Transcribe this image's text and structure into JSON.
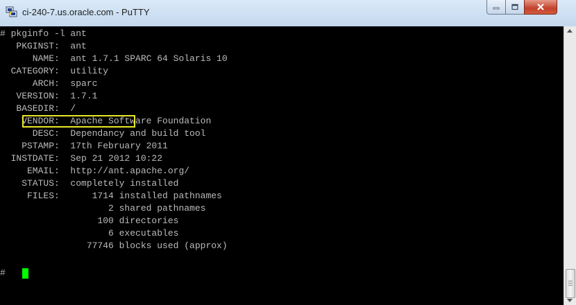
{
  "window": {
    "title": "ci-240-7.us.oracle.com - PuTTY",
    "icon": "putty-icon",
    "controls": {
      "minimize": "minimize-icon",
      "maximize": "maximize-icon",
      "close": "close-icon"
    }
  },
  "terminal": {
    "lines": [
      "# pkginfo -l ant",
      "   PKGINST:  ant",
      "      NAME:  ant 1.7.1 SPARC 64 Solaris 10",
      "  CATEGORY:  utility",
      "      ARCH:  sparc",
      "   VERSION:  1.7.1",
      "   BASEDIR:  /",
      "    VENDOR:  Apache Software Foundation",
      "      DESC:  Dependancy and build tool",
      "    PSTAMP:  17th February 2011",
      "  INSTDATE:  Sep 21 2012 10:22",
      "     EMAIL:  http://ant.apache.org/",
      "    STATUS:  completely installed",
      "     FILES:      1714 installed pathnames",
      "                    2 shared pathnames",
      "                  100 directories",
      "                    6 executables",
      "                77746 blocks used (approx)",
      "",
      "# "
    ],
    "colors": {
      "background": "#000000",
      "text": "#bbbbbb",
      "cursor": "#00ff00",
      "highlight": "#e8e82a"
    }
  }
}
